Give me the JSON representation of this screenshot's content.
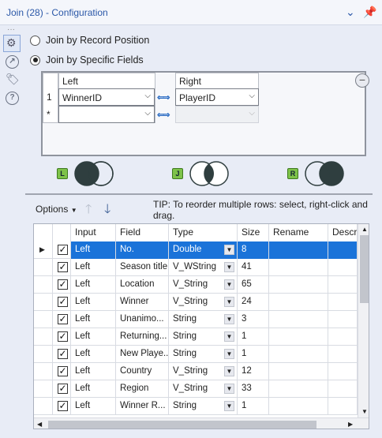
{
  "titlebar": {
    "title": "Join (28) - Configuration"
  },
  "join_mode": {
    "by_position_label": "Join by Record Position",
    "by_fields_label": "Join by Specific Fields",
    "selected": "by_fields"
  },
  "join_table": {
    "left_header": "Left",
    "right_header": "Right",
    "rows": [
      {
        "marker": "1",
        "left": "WinnerID",
        "right": "PlayerID"
      },
      {
        "marker": "*",
        "left": "",
        "right": ""
      }
    ]
  },
  "outputs": [
    {
      "badge": "L",
      "name": "left-output"
    },
    {
      "badge": "J",
      "name": "join-output"
    },
    {
      "badge": "R",
      "name": "right-output"
    }
  ],
  "toolbar": {
    "options_label": "Options",
    "tip": "TIP: To reorder multiple rows: select, right-click and drag."
  },
  "grid": {
    "columns": [
      "",
      "",
      "Input",
      "Field",
      "Type",
      "Size",
      "Rename",
      "Descr"
    ],
    "rows": [
      {
        "checked": true,
        "input": "Left",
        "field": "No.",
        "type": "Double",
        "size": "8",
        "selected": true
      },
      {
        "checked": true,
        "input": "Left",
        "field": "Season title",
        "type": "V_WString",
        "size": "41"
      },
      {
        "checked": true,
        "input": "Left",
        "field": "Location",
        "type": "V_String",
        "size": "65"
      },
      {
        "checked": true,
        "input": "Left",
        "field": "Winner",
        "type": "V_String",
        "size": "24"
      },
      {
        "checked": true,
        "input": "Left",
        "field": "Unanimo...",
        "type": "String",
        "size": "3"
      },
      {
        "checked": true,
        "input": "Left",
        "field": "Returning...",
        "type": "String",
        "size": "1"
      },
      {
        "checked": true,
        "input": "Left",
        "field": "New Playe...",
        "type": "String",
        "size": "1"
      },
      {
        "checked": true,
        "input": "Left",
        "field": "Country",
        "type": "V_String",
        "size": "12"
      },
      {
        "checked": true,
        "input": "Left",
        "field": "Region",
        "type": "V_String",
        "size": "33"
      },
      {
        "checked": true,
        "input": "Left",
        "field": "Winner R...",
        "type": "String",
        "size": "1"
      }
    ]
  },
  "colors": {
    "accent": "#2b58a8",
    "selection": "#1a73d9",
    "badge": "#7ec24a"
  }
}
